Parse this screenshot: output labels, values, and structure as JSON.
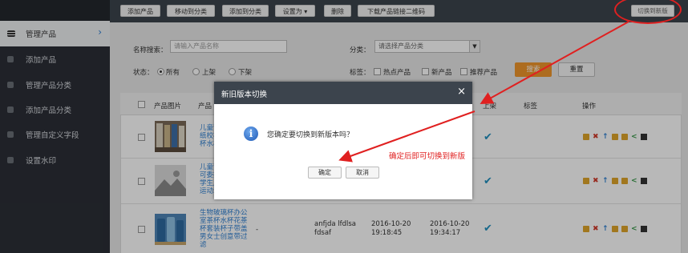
{
  "sidebar": {
    "items": [
      {
        "label": "管理产品",
        "active": true,
        "icon": "list-icon"
      },
      {
        "label": "添加产品",
        "icon": "plus-icon"
      },
      {
        "label": "管理产品分类",
        "icon": "category-icon"
      },
      {
        "label": "添加产品分类",
        "icon": "plus-icon"
      },
      {
        "label": "管理自定义字段",
        "icon": "field-icon"
      },
      {
        "label": "设置水印",
        "icon": "watermark-icon"
      }
    ],
    "chevron": "›"
  },
  "toolbar": {
    "buttons": [
      "添加产品",
      "移动到分类",
      "添加到分类",
      "设置为 ▾",
      "删除",
      "下载产品链接二维码"
    ],
    "switch_label": "切换到新版"
  },
  "filter": {
    "name_label": "名称搜索：",
    "name_placeholder": "请输入产品名称",
    "category_label": "分类：",
    "category_value": "请选择产品分类",
    "status_label": "状态：",
    "status_options": [
      "所有",
      "上架",
      "下架"
    ],
    "tags_label": "标签：",
    "tags": [
      "热点产品",
      "新产品",
      "推荐产品"
    ],
    "search_label": "搜索",
    "reset_label": "重置"
  },
  "table": {
    "headers": {
      "image": "产品图片",
      "name": "产品",
      "listed": "上架",
      "tag": "标签",
      "ops": "操作"
    },
    "rows": [
      {
        "name": [
          "儿童营",
          "纸校样",
          "杯水杯"
        ],
        "listed": true
      },
      {
        "name": [
          "儿童营",
          "可委托",
          "学生用",
          "运动水"
        ],
        "listed": true
      },
      {
        "name": [
          "生物玻璃杯办公",
          "室茶杯水杯花茶",
          "杯套装杯子带盖",
          "男女士创意带过",
          "滤"
        ],
        "dash": "-",
        "owner": [
          "anfjda lfdlsa",
          "fdsaf"
        ],
        "created": [
          "2016-10-20",
          "19:18:45"
        ],
        "updated": [
          "2016-10-20",
          "19:34:17"
        ],
        "listed": true
      }
    ],
    "op_icons": [
      "folder-icon",
      "delete-icon",
      "up-icon",
      "folder-icon",
      "copy-icon",
      "share-icon",
      "qrcode-icon"
    ]
  },
  "modal": {
    "title": "新旧版本切换",
    "close": "×",
    "message": "您确定要切换到新版本吗？",
    "ok_label": "确定",
    "cancel_label": "取消"
  },
  "annotation": {
    "text": "确定后即可切换到新版"
  },
  "colors": {
    "accent": "#f0962b",
    "annotation": "#e02020",
    "sidebar": "#2b2f36",
    "link": "#2d7fd2"
  }
}
